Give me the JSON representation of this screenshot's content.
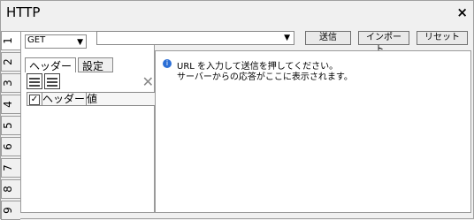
{
  "window": {
    "title": "HTTP"
  },
  "icons": {
    "close": "close-icon",
    "info": "info-icon"
  },
  "vertical_tabs": [
    "1",
    "2",
    "3",
    "4",
    "5",
    "6",
    "7",
    "8",
    "9"
  ],
  "left": {
    "method": {
      "value": "GET"
    },
    "tabs": [
      {
        "label": "ヘッダー"
      },
      {
        "label": "設定"
      }
    ],
    "header_table": {
      "columns": [
        "ヘッダー",
        "値"
      ]
    }
  },
  "toolbar": {
    "send_label": "送信",
    "import_label": "インポート...",
    "reset_label": "リセット"
  },
  "main": {
    "url_value": "",
    "message_line1": "URL を入力して送信を押してください。",
    "message_line2": "サーバーからの応答がここに表示されます。"
  }
}
